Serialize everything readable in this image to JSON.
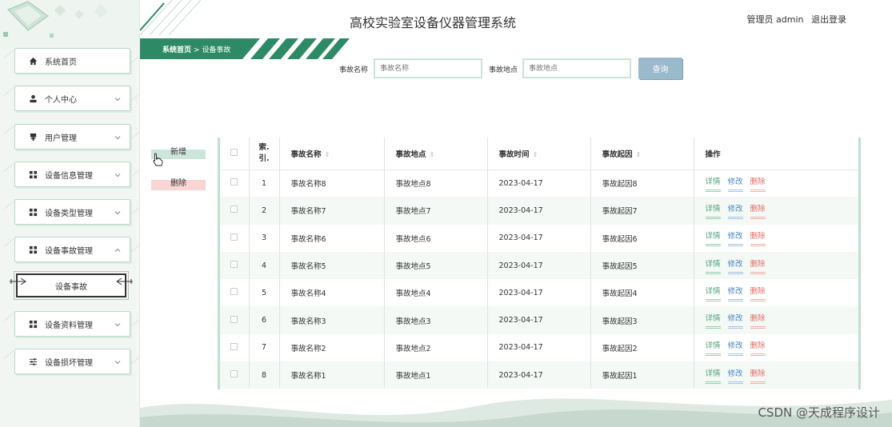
{
  "header": {
    "app_title": "高校实验室设备仪器管理系统",
    "user_label": "管理员 admin",
    "logout": "退出登录"
  },
  "breadcrumb": {
    "home": "系统首页",
    "separator": ">",
    "current": "设备事故"
  },
  "sidebar": {
    "items": [
      {
        "label": "系统首页",
        "icon": "home-icon",
        "has_chevron": false
      },
      {
        "label": "个人中心",
        "icon": "person-icon",
        "has_chevron": true
      },
      {
        "label": "用户管理",
        "icon": "user-manage-icon",
        "has_chevron": true
      },
      {
        "label": "设备信息管理",
        "icon": "grid-icon",
        "has_chevron": true
      },
      {
        "label": "设备类型管理",
        "icon": "grid-icon",
        "has_chevron": true
      },
      {
        "label": "设备事故管理",
        "icon": "grid-icon",
        "has_chevron": true,
        "expanded": true
      },
      {
        "label": "设备资料管理",
        "icon": "grid-icon",
        "has_chevron": true
      },
      {
        "label": "设备损坏管理",
        "icon": "sliders-icon",
        "has_chevron": true
      }
    ],
    "active_sub": "设备事故"
  },
  "search": {
    "name_label": "事故名称",
    "name_placeholder": "事故名称",
    "location_label": "事故地点",
    "location_placeholder": "事故地点",
    "button": "查询"
  },
  "actions": {
    "add": "新增",
    "delete": "删除"
  },
  "table": {
    "columns": [
      "索引",
      "事故名称",
      "事故地点",
      "事故时间",
      "事故起因",
      "操作"
    ],
    "index_header": "索.\n引.",
    "rows": [
      {
        "idx": "1",
        "name": "事故名称8",
        "location": "事故地点8",
        "time": "2023-04-17",
        "cause": "事故起因8"
      },
      {
        "idx": "2",
        "name": "事故名称7",
        "location": "事故地点7",
        "time": "2023-04-17",
        "cause": "事故起因7"
      },
      {
        "idx": "3",
        "name": "事故名称6",
        "location": "事故地点6",
        "time": "2023-04-17",
        "cause": "事故起因6"
      },
      {
        "idx": "4",
        "name": "事故名称5",
        "location": "事故地点5",
        "time": "2023-04-17",
        "cause": "事故起因5"
      },
      {
        "idx": "5",
        "name": "事故名称4",
        "location": "事故地点4",
        "time": "2023-04-17",
        "cause": "事故起因4"
      },
      {
        "idx": "6",
        "name": "事故名称3",
        "location": "事故地点3",
        "time": "2023-04-17",
        "cause": "事故起因3"
      },
      {
        "idx": "7",
        "name": "事故名称2",
        "location": "事故地点2",
        "time": "2023-04-17",
        "cause": "事故起因2"
      },
      {
        "idx": "8",
        "name": "事故名称1",
        "location": "事故地点1",
        "time": "2023-04-17",
        "cause": "事故起因1"
      }
    ],
    "ops": {
      "detail": "详情",
      "edit": "修改",
      "delete": "删除"
    }
  },
  "watermark": "CSDN @天成程序设计",
  "colors": {
    "accent_green": "#2e8a66",
    "search_button": "#9bb9cc",
    "link_detail": "#4e9e79",
    "link_edit": "#4a86c3",
    "link_delete": "#e06a63"
  }
}
